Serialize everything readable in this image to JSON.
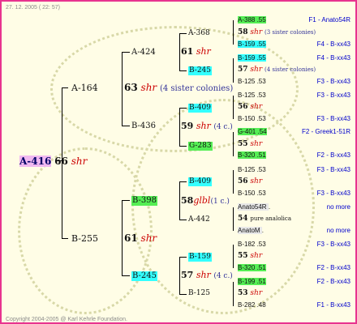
{
  "header": {
    "date": "27. 12. 2005 ( 22: 57)"
  },
  "footer": {
    "copyright": "Copyright 2004-2005 @ Karl Kehrle Foundation."
  },
  "root": {
    "code": "A-416",
    "num": "66",
    "shr": "shr"
  },
  "gen1": {
    "upper": {
      "code": "A-164",
      "num": "63",
      "shr": "shr",
      "colonies": "(4 sister colonies)"
    },
    "lower": {
      "code": "B-255",
      "num": "61",
      "shr": "shr"
    }
  },
  "gen2": [
    {
      "code": "A-424",
      "num": "61",
      "shr": "shr"
    },
    {
      "code": "B-436",
      "num": "59",
      "shr": "shr",
      "colonies": "(4 c.)"
    },
    {
      "code": "B-398",
      "num": "58",
      "shr": "glbl",
      "colonies": "(1 c.)"
    },
    {
      "code": "B-245",
      "num": "57",
      "shr": "shr",
      "colonies": "(4 c.)"
    }
  ],
  "gen3": [
    {
      "code": "A-368"
    },
    {
      "code": "B-245",
      "num": "57",
      "shr": "shr",
      "colonies": "(4 sister colonies)"
    },
    {
      "code": "B-409",
      "num": "56",
      "shr": "shr"
    },
    {
      "code": "G-283",
      "num": "55",
      "shr": "shr"
    },
    {
      "code": "B-409",
      "num": "56",
      "shr": "shr"
    },
    {
      "code": "A-442",
      "num": "54",
      "shr": "pure analolica"
    },
    {
      "code": "B-159",
      "num": "55",
      "shr": "shr"
    },
    {
      "code": "B-125",
      "num": "53",
      "shr": "shr"
    }
  ],
  "a368_detail": {
    "num": "58",
    "shr": "shr",
    "colonies": "(3 sister colonies)"
  },
  "gen4": [
    {
      "code": "A-388",
      "val": ".55",
      "right": "F1 - Anato54R"
    },
    {
      "code": "B-159",
      "val": ".55",
      "right": "F4 - B-xx43"
    },
    {
      "code": "B-159",
      "val": ".55",
      "right": "F4 - B-xx43"
    },
    {
      "code": "B-125",
      "val": ".53",
      "right": "F3 - B-xx43"
    },
    {
      "code": "B-125",
      "val": ".53",
      "right": "F3 - B-xx43"
    },
    {
      "code": "B-150",
      "val": ".53",
      "right": "F3 - B-xx43"
    },
    {
      "code": "G-401",
      "val": ".54",
      "right": "F2 - Greek1-51R"
    },
    {
      "code": "B-320",
      "val": ".51",
      "right": "F2 - B-xx43"
    },
    {
      "code": "B-125",
      "val": ".53",
      "right": "F3 - B-xx43"
    },
    {
      "code": "B-150",
      "val": ".53",
      "right": "F3 - B-xx43"
    },
    {
      "code": "Anato54R",
      "val": ".",
      "right": "no more"
    },
    {
      "code": "AnatoM",
      "val": ".",
      "right": "no more"
    },
    {
      "code": "B-182",
      "val": ".53",
      "right": "F3 - B-xx43"
    },
    {
      "code": "B-320",
      "val": ".51",
      "right": "F2 - B-xx43"
    },
    {
      "code": "B-199",
      "val": ".51",
      "right": "F2 - B-xx43"
    },
    {
      "code": "B-282",
      "val": ".48",
      "right": "F1 - B-xx43"
    }
  ]
}
